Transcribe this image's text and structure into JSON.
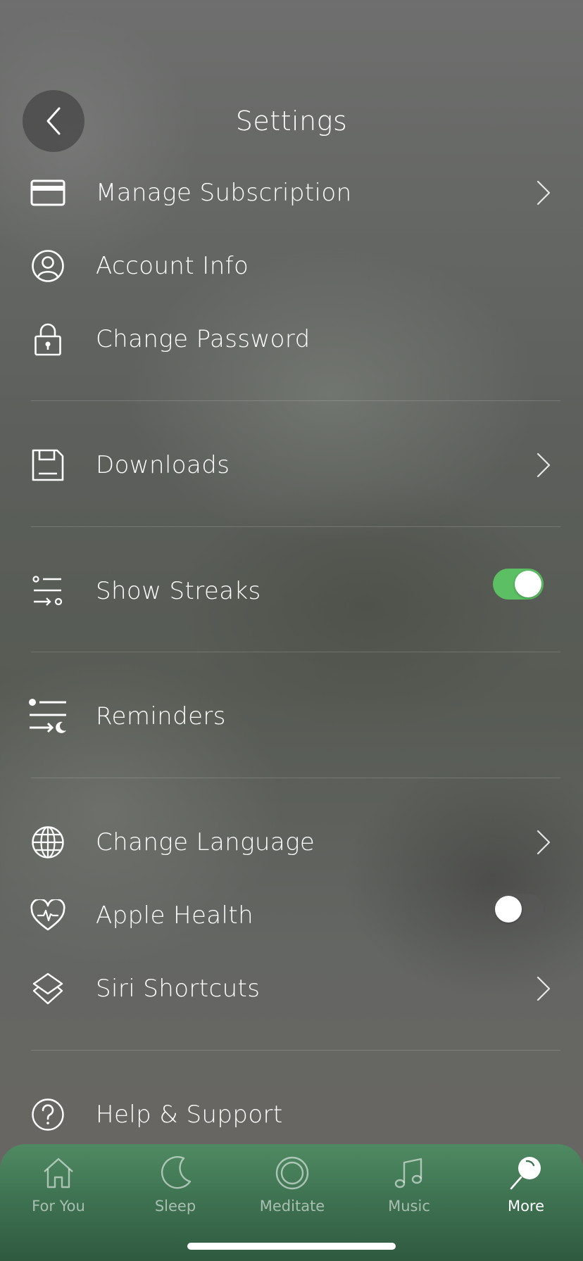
{
  "header": {
    "title": "Settings",
    "back_icon": "chevron-left-icon"
  },
  "rows": {
    "manage_subscription": {
      "label": "Manage Subscription",
      "icon": "credit-card-icon"
    },
    "account_info": {
      "label": "Account Info",
      "icon": "user-circle-icon"
    },
    "change_password": {
      "label": "Change Password",
      "icon": "lock-icon"
    },
    "downloads": {
      "label": "Downloads",
      "icon": "floppy-disk-icon"
    },
    "show_streaks": {
      "label": "Show Streaks",
      "icon": "streaks-icon",
      "enabled": true
    },
    "reminders": {
      "label": "Reminders",
      "icon": "reminders-icon"
    },
    "change_language": {
      "label": "Change Language",
      "icon": "globe-icon"
    },
    "apple_health": {
      "label": "Apple Health",
      "icon": "heart-pulse-icon",
      "enabled": false
    },
    "siri_shortcuts": {
      "label": "Siri Shortcuts",
      "icon": "shortcuts-icon"
    },
    "help_support": {
      "label": "Help & Support",
      "icon": "question-circle-icon"
    }
  },
  "tabbar": {
    "tabs": [
      {
        "label": "For You",
        "icon": "home-icon"
      },
      {
        "label": "Sleep",
        "icon": "moon-icon"
      },
      {
        "label": "Meditate",
        "icon": "circle-icon"
      },
      {
        "label": "Music",
        "icon": "music-note-icon"
      },
      {
        "label": "More",
        "icon": "more-icon"
      }
    ],
    "active": "More"
  },
  "colors": {
    "toggle_on": "#5cbf63",
    "tabbar": "#3f7352"
  }
}
